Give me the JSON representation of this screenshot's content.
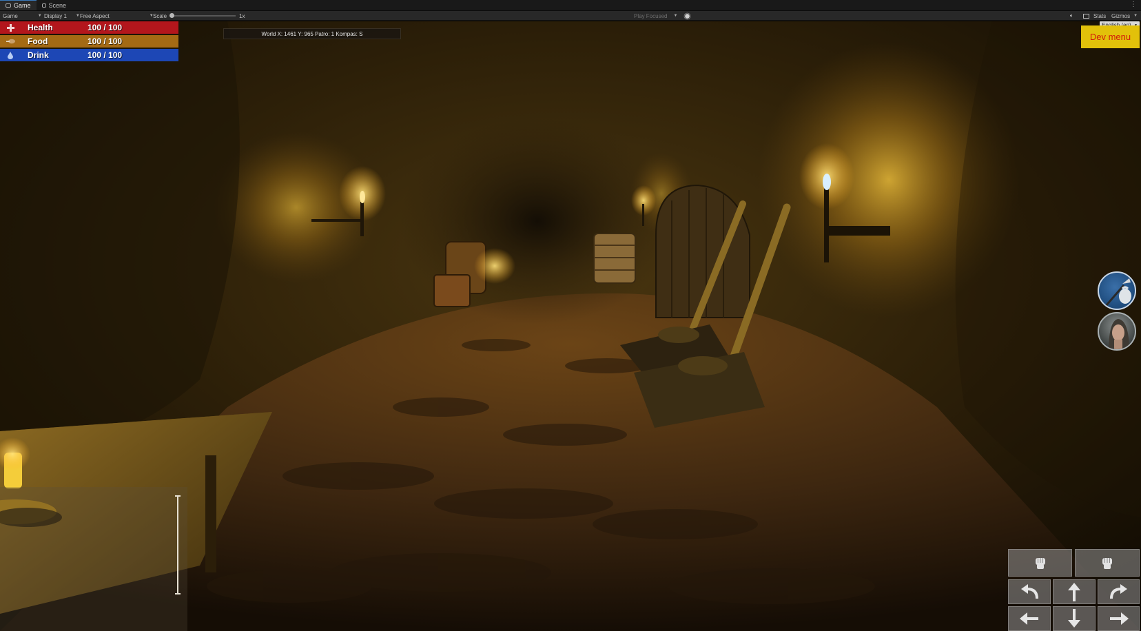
{
  "editor": {
    "tabs": [
      {
        "label": "Game",
        "icon": "gamepad-icon",
        "active": true
      },
      {
        "label": "Scene",
        "icon": "grid-icon",
        "active": false
      }
    ],
    "toolbar": {
      "mode": "Game",
      "display": "Display 1",
      "aspect": "Free Aspect",
      "scale_label": "Scale",
      "scale_value": "1x",
      "play_mode": "Play Focused",
      "stats": "Stats",
      "gizmos": "Gizmos"
    }
  },
  "hud": {
    "stats": [
      {
        "key": "health",
        "label": "Health",
        "value": "100 / 100",
        "icon": "plus-cross-icon",
        "color": "#b3161c"
      },
      {
        "key": "food",
        "label": "Food",
        "value": "100 / 100",
        "icon": "meat-icon",
        "color": "#a46a14"
      },
      {
        "key": "drink",
        "label": "Drink",
        "value": "100 / 100",
        "icon": "water-drop-icon",
        "color": "#1d47b5"
      }
    ],
    "coordinates": "World X: 1461 Y: 965 Patro: 1 Kompas: S",
    "language": "English (en)",
    "dev_menu": "Dev menu",
    "dev_menu_colors": {
      "bg": "#e2c10a",
      "text": "#d11b0a"
    },
    "side_buttons": [
      {
        "name": "tool-item-button",
        "icon": "shovel-sack-icon"
      },
      {
        "name": "character-portrait-button",
        "icon": "character-portrait-icon"
      }
    ],
    "controls": {
      "top_row": [
        "fist-left-icon",
        "fist-right-icon"
      ],
      "middle_row": [
        "turn-left-icon",
        "arrow-up-icon",
        "turn-right-icon"
      ],
      "bottom_row": [
        "arrow-left-icon",
        "arrow-down-icon",
        "arrow-right-icon"
      ]
    }
  }
}
